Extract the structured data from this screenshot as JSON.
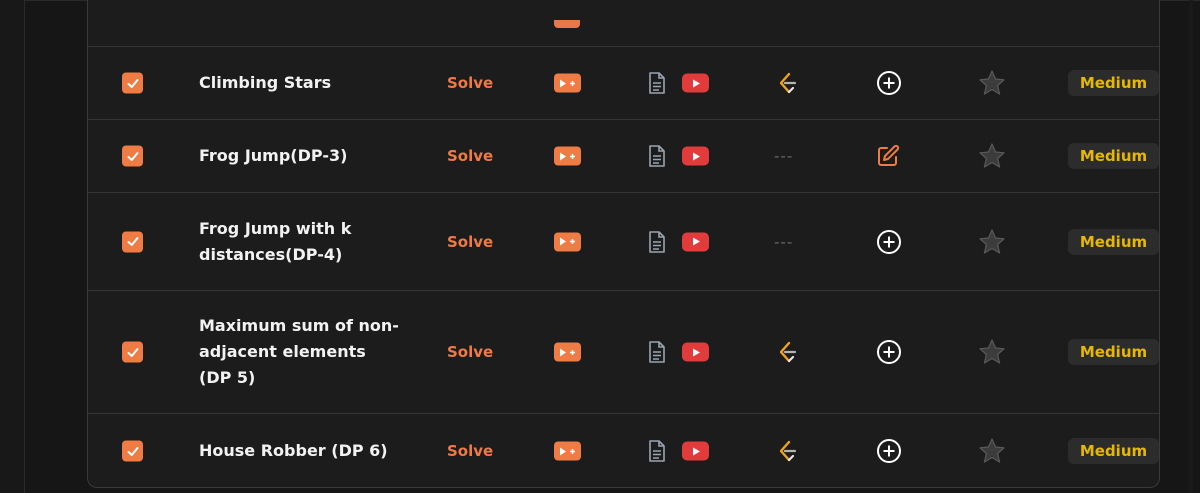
{
  "colors": {
    "accent": "#ef7b45",
    "difficulty_medium": "#e6b800",
    "youtube": "#e23b3b"
  },
  "actions": {
    "solve_label": "Solve",
    "no_link": "---"
  },
  "rows": [
    {
      "title": "Climbing Stars",
      "checked": true,
      "leetcode": true,
      "note": "add",
      "difficulty": "Medium"
    },
    {
      "title": "Frog Jump(DP-3)",
      "checked": true,
      "leetcode": false,
      "note": "edit",
      "difficulty": "Medium"
    },
    {
      "title": "Frog Jump with k distances(DP-4)",
      "checked": true,
      "leetcode": false,
      "note": "add",
      "difficulty": "Medium"
    },
    {
      "title": "Maximum sum of non-adjacent elements (DP 5)",
      "checked": true,
      "leetcode": true,
      "note": "add",
      "difficulty": "Medium"
    },
    {
      "title": "House Robber (DP 6)",
      "checked": true,
      "leetcode": true,
      "note": "add",
      "difficulty": "Medium"
    }
  ]
}
